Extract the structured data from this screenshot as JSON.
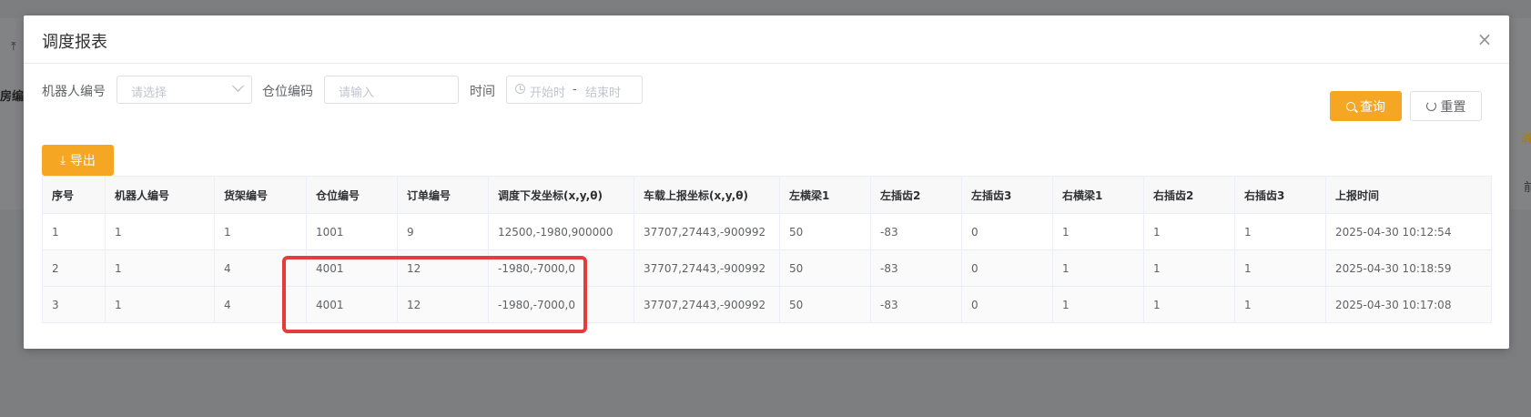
{
  "background": {
    "top_icon": "⤒",
    "left_fragment": "房编",
    "right_fragment": "消",
    "right_small": "前"
  },
  "dialog": {
    "title": "调度报表",
    "close_symbol": "×"
  },
  "filters": {
    "robot_label": "机器人编号",
    "robot_placeholder": "请选择",
    "location_label": "仓位编码",
    "location_placeholder": "请输入",
    "time_label": "时间",
    "time_start_placeholder": "开始时",
    "time_separator": "-",
    "time_end_placeholder": "结束时"
  },
  "buttons": {
    "query": "查询",
    "reset": "重置",
    "export": "导出"
  },
  "colors": {
    "accent": "#f5a623",
    "highlight": "#e63b3b"
  },
  "table": {
    "headers": [
      "序号",
      "机器人编号",
      "货架编号",
      "仓位编号",
      "订单编号",
      "调度下发坐标(x,y,θ)",
      "车载上报坐标(x,y,θ)",
      "左横梁1",
      "左插齿2",
      "左插齿3",
      "右横梁1",
      "右插齿2",
      "右插齿3",
      "上报时间"
    ],
    "rows": [
      [
        "1",
        "1",
        "1",
        "1001",
        "9",
        "12500,-1980,900000",
        "37707,27443,-900992",
        "50",
        "-83",
        "0",
        "1",
        "1",
        "1",
        "2025-04-30 10:12:54"
      ],
      [
        "2",
        "1",
        "4",
        "4001",
        "12",
        "-1980,-7000,0",
        "37707,27443,-900992",
        "50",
        "-83",
        "0",
        "1",
        "1",
        "1",
        "2025-04-30 10:18:59"
      ],
      [
        "3",
        "1",
        "4",
        "4001",
        "12",
        "-1980,-7000,0",
        "37707,27443,-900992",
        "50",
        "-83",
        "0",
        "1",
        "1",
        "1",
        "2025-04-30 10:17:08"
      ]
    ]
  }
}
